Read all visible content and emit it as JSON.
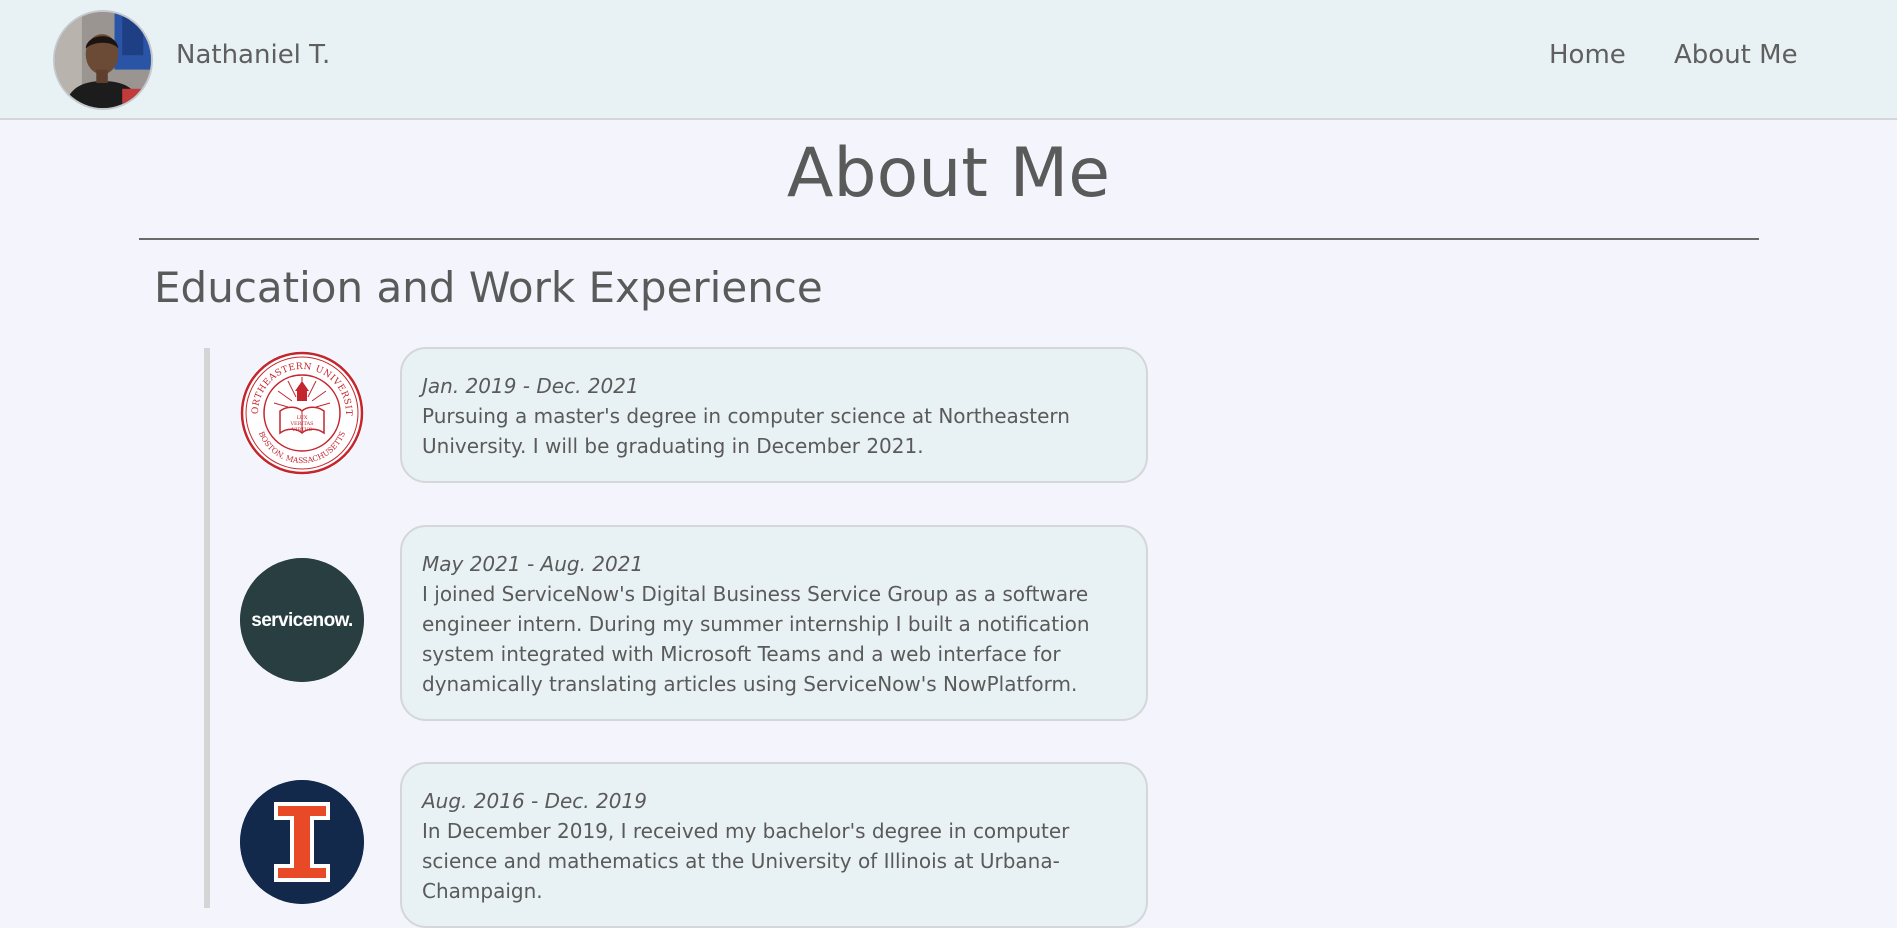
{
  "header": {
    "name": "Nathaniel T.",
    "nav": [
      {
        "label": "Home"
      },
      {
        "label": "About Me"
      }
    ]
  },
  "page": {
    "title": "About Me",
    "section_title": "Education and Work Experience"
  },
  "timeline": [
    {
      "date": "Jan. 2019 - Dec. 2021",
      "description": "Pursuing a master's degree in computer science at Northeastern University. I will be graduating in December 2021.",
      "logo": "northeastern-university-seal-logo",
      "logo_text_top": "NORTHEASTERN UNIVERSITY",
      "logo_text_bottom": "BOSTON, MASSACHUSETTS",
      "logo_motto": "LUX VERITAS VIRTUS"
    },
    {
      "date": "May 2021 - Aug. 2021",
      "description": "I joined ServiceNow's Digital Business Service Group as a software engineer intern. During my summer internship I built a notification system integrated with Microsoft Teams and a web interface for dynamically translating articles using ServiceNow's NowPlatform.",
      "logo": "servicenow-logo",
      "logo_text": "servicenow."
    },
    {
      "date": "Aug. 2016 - Dec. 2019",
      "description": "In December 2019, I received my bachelor's degree in computer science and mathematics at the University of Illinois at Urbana-Champaign.",
      "logo": "illinois-block-i-logo"
    }
  ],
  "colors": {
    "page_bg": "#f4f5fc",
    "header_bg": "#e8f1f3",
    "card_bg": "#e8f1f3",
    "text": "#5a5a5a",
    "northeastern_red": "#c4262e",
    "servicenow_dark": "#293e40",
    "servicenow_green": "#62d84e",
    "illinois_blue": "#13294b",
    "illinois_orange": "#e84a27"
  }
}
